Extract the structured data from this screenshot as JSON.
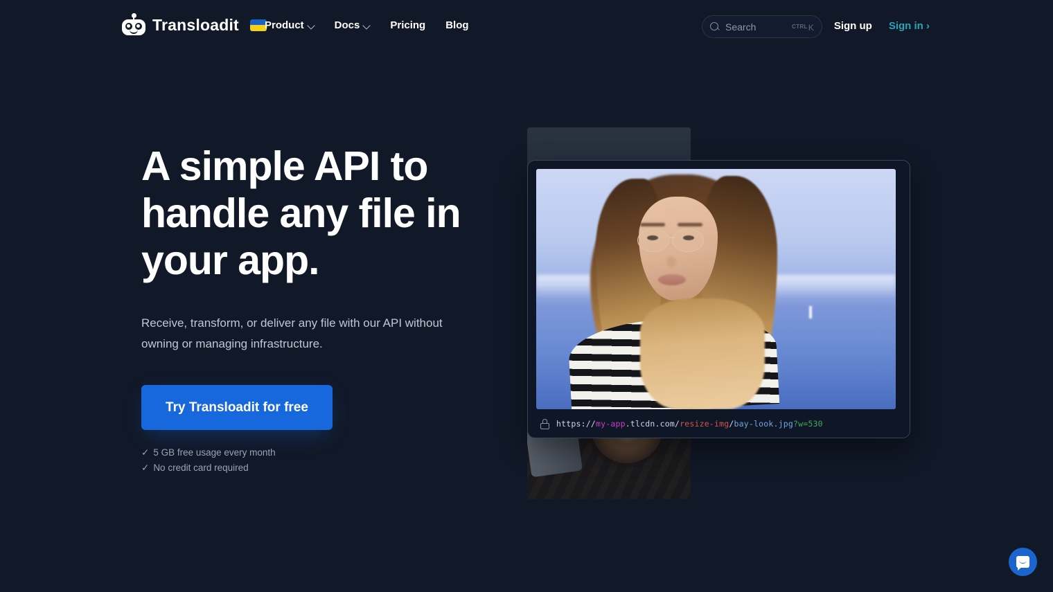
{
  "brand": {
    "name": "Transloadit",
    "logo_icon": "robot-logo-icon",
    "flag_icon": "ukraine-flag-icon"
  },
  "nav": {
    "items": [
      {
        "label": "Product",
        "has_dropdown": true
      },
      {
        "label": "Docs",
        "has_dropdown": true
      },
      {
        "label": "Pricing",
        "has_dropdown": false
      },
      {
        "label": "Blog",
        "has_dropdown": false
      }
    ]
  },
  "search": {
    "placeholder": "Search",
    "value": "",
    "shortcut_modifier": "CTRL",
    "shortcut_key": "K",
    "icon": "search-icon"
  },
  "auth": {
    "signup_label": "Sign up",
    "signin_label": "Sign in ›"
  },
  "hero": {
    "title": "A simple API to handle any file in your app.",
    "subtitle": "Receive, transform, or deliver any file with our API without owning or managing infrastructure.",
    "cta_label": "Try Transloadit for free",
    "perks": [
      {
        "tick": "✓",
        "label": "5 GB free usage every month"
      },
      {
        "tick": "✓",
        "label": "No credit card required"
      }
    ]
  },
  "browser_mock": {
    "lock_icon": "lock-icon",
    "url": {
      "protocol": "https://",
      "subdomain": "my-app",
      "host": ".tlcdn.com/",
      "path": "resize-img",
      "separator": "/",
      "file": "bay-look.jpg",
      "query": "?w=530",
      "full": "https://my-app.tlcdn.com/resize-img/bay-look.jpg?w=530"
    },
    "image_alt": "Portrait of a woman with glasses in front of a bay"
  },
  "chat_widget": {
    "icon": "intercom-chat-icon",
    "label": "Open chat"
  },
  "colors": {
    "page_background": "#111827",
    "accent_blue": "#1668dc",
    "signin_teal": "#2ba3b8",
    "text_primary": "#ffffff",
    "text_muted": "#9aa6b8",
    "url_subdomain": "#c93ec0",
    "url_path": "#d7544a",
    "url_file": "#6fa8e0",
    "url_query": "#3fa95e",
    "chat_blue": "#1b66cc"
  }
}
